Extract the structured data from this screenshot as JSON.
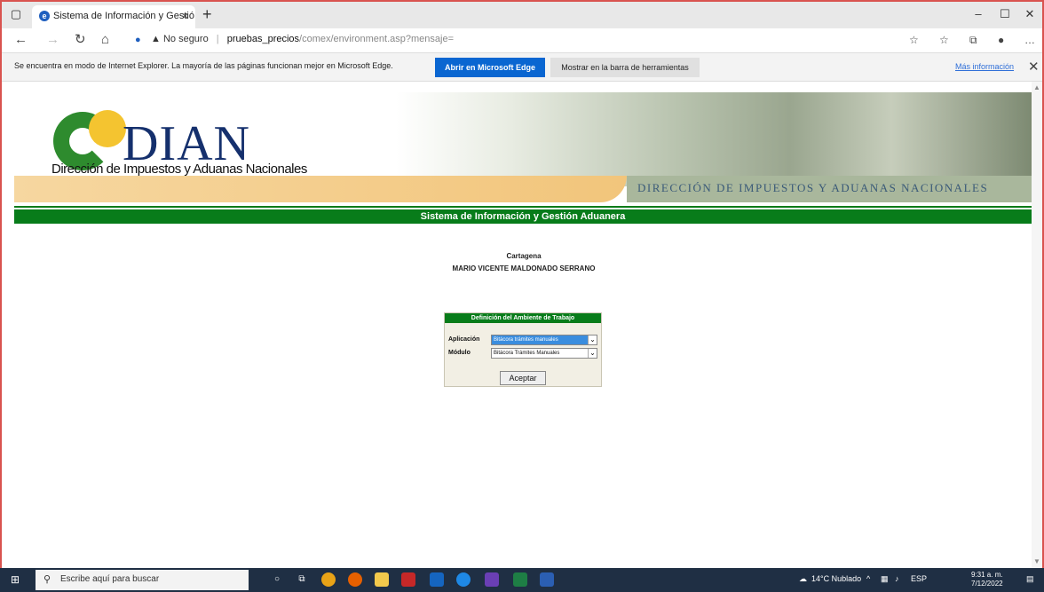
{
  "window": {
    "tab_title": "Sistema de Información y Gestió",
    "tab_close": "×",
    "new_tab": "+",
    "minimize": "–",
    "restore": "☐",
    "close": "✕"
  },
  "address_bar": {
    "security_label": "No seguro",
    "host": "pruebas_precios",
    "path": "/comex/environment.asp?mensaje="
  },
  "infobar": {
    "message": "Se encuentra en modo de Internet Explorer. La mayoría de las páginas funcionan mejor en Microsoft Edge.",
    "open_edge_label": "Abrir en Microsoft Edge",
    "show_toolbar_label": "Mostrar en la barra de herramientas",
    "more_info_label": "Más información",
    "close": "✕"
  },
  "banner": {
    "logo_text": "DIAN",
    "logo_subtitle": "Dirección de Impuestos y Aduanas Nacionales",
    "caption": "DIRECCIÓN DE IMPUESTOS Y ADUANAS NACIONALES"
  },
  "page": {
    "system_title": "Sistema de Información y Gestión Aduanera",
    "city": "Cartagena",
    "user_name": "MARIO VICENTE MALDONADO SERRANO"
  },
  "form": {
    "title": "Definición del Ambiente de Trabajo",
    "application_label": "Aplicación",
    "application_value": "Bitácora trámites manuales",
    "module_label": "Módulo",
    "module_value": "Bitácora Trámites Manuales",
    "accept_label": "Aceptar"
  },
  "taskbar": {
    "search_placeholder": "Escribe aquí para buscar",
    "weather": "14°C Nublado",
    "language": "ESP",
    "time": "9:31 a. m.",
    "date": "7/12/2022"
  },
  "colors": {
    "dian_green": "#087c1a",
    "dian_blue": "#15306d",
    "edge_button": "#0a66d1",
    "taskbar": "#1f2f44"
  }
}
